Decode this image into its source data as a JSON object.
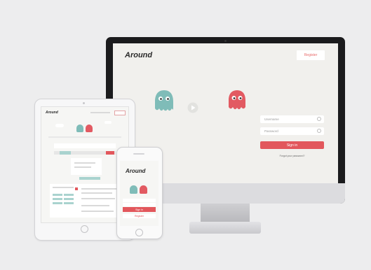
{
  "desktop": {
    "logo": "Around",
    "register_label": "Register",
    "username_placeholder": "Username",
    "password_placeholder": "Password",
    "signin_label": "Sign in",
    "forgot_label": "Forgot your password?"
  },
  "tablet": {
    "logo": "Around"
  },
  "phone": {
    "logo": "Around",
    "signin_label": "Sign in",
    "register_label": "Register"
  },
  "colors": {
    "accent_red": "#e2575c",
    "mascot_teal": "#7fbcb8",
    "mascot_red": "#e25a62",
    "background": "#ededee"
  }
}
